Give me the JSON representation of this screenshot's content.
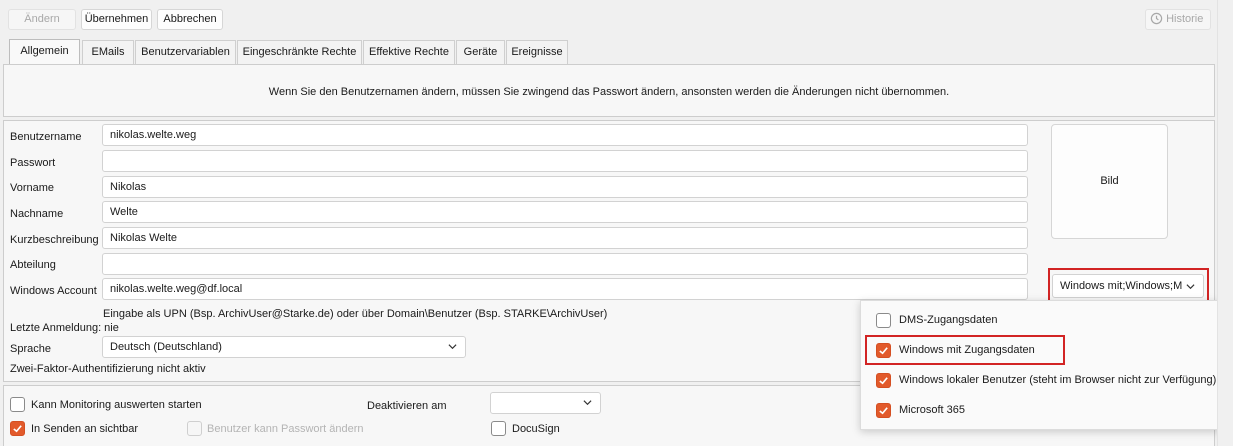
{
  "toolbar": {
    "change_label": "Ändern",
    "apply_label": "Übernehmen",
    "cancel_label": "Abbrechen",
    "history_label": "Historie"
  },
  "tabs": [
    {
      "label": "Allgemein"
    },
    {
      "label": "EMails"
    },
    {
      "label": "Benutzervariablen"
    },
    {
      "label": "Eingeschränkte Rechte"
    },
    {
      "label": "Effektive Rechte"
    },
    {
      "label": "Geräte"
    },
    {
      "label": "Ereignisse"
    }
  ],
  "notice": "Wenn Sie den Benutzernamen ändern, müssen Sie zwingend das Passwort ändern, ansonsten werden die Änderungen nicht übernommen.",
  "form": {
    "username_label": "Benutzername",
    "username_value": "nikolas.welte.weg",
    "password_label": "Passwort",
    "password_value": "",
    "firstname_label": "Vorname",
    "firstname_value": "Nikolas",
    "lastname_label": "Nachname",
    "lastname_value": "Welte",
    "shortdesc_label": "Kurzbeschreibung",
    "shortdesc_value": "Nikolas Welte",
    "department_label": "Abteilung",
    "department_value": "",
    "winaccount_label": "Windows Account",
    "winaccount_value": "nikolas.welte.weg@df.local",
    "winaccount_hint": "Eingabe als UPN (Bsp. ArchivUser@Starke.de) oder über Domain\\Benutzer (Bsp. STARKE\\ArchivUser)",
    "last_login": "Letzte Anmeldung: nie",
    "language_label": "Sprache",
    "language_value": "Deutsch (Deutschland)",
    "twofactor": "Zwei-Faktor-Authentifizierung nicht aktiv",
    "image_label": "Bild",
    "login_mode_value": "Windows mit;Windows;M"
  },
  "bottom": {
    "monitoring_label": "Kann Monitoring auswerten starten",
    "deactivate_label": "Deaktivieren am",
    "deactivate_value": "",
    "send_visible_label": "In Senden an sichtbar",
    "change_pw_label": "Benutzer kann Passwort ändern",
    "docusign_label": "DocuSign"
  },
  "popup": {
    "items": [
      {
        "label": "DMS-Zugangsdaten",
        "checked": false
      },
      {
        "label": "Windows mit Zugangsdaten",
        "checked": true
      },
      {
        "label": "Windows lokaler Benutzer (steht im Browser nicht zur Verfügung)",
        "checked": true
      },
      {
        "label": "Microsoft 365",
        "checked": true
      }
    ]
  },
  "colors": {
    "accent": "#e25a2b",
    "highlight": "#d22424"
  }
}
